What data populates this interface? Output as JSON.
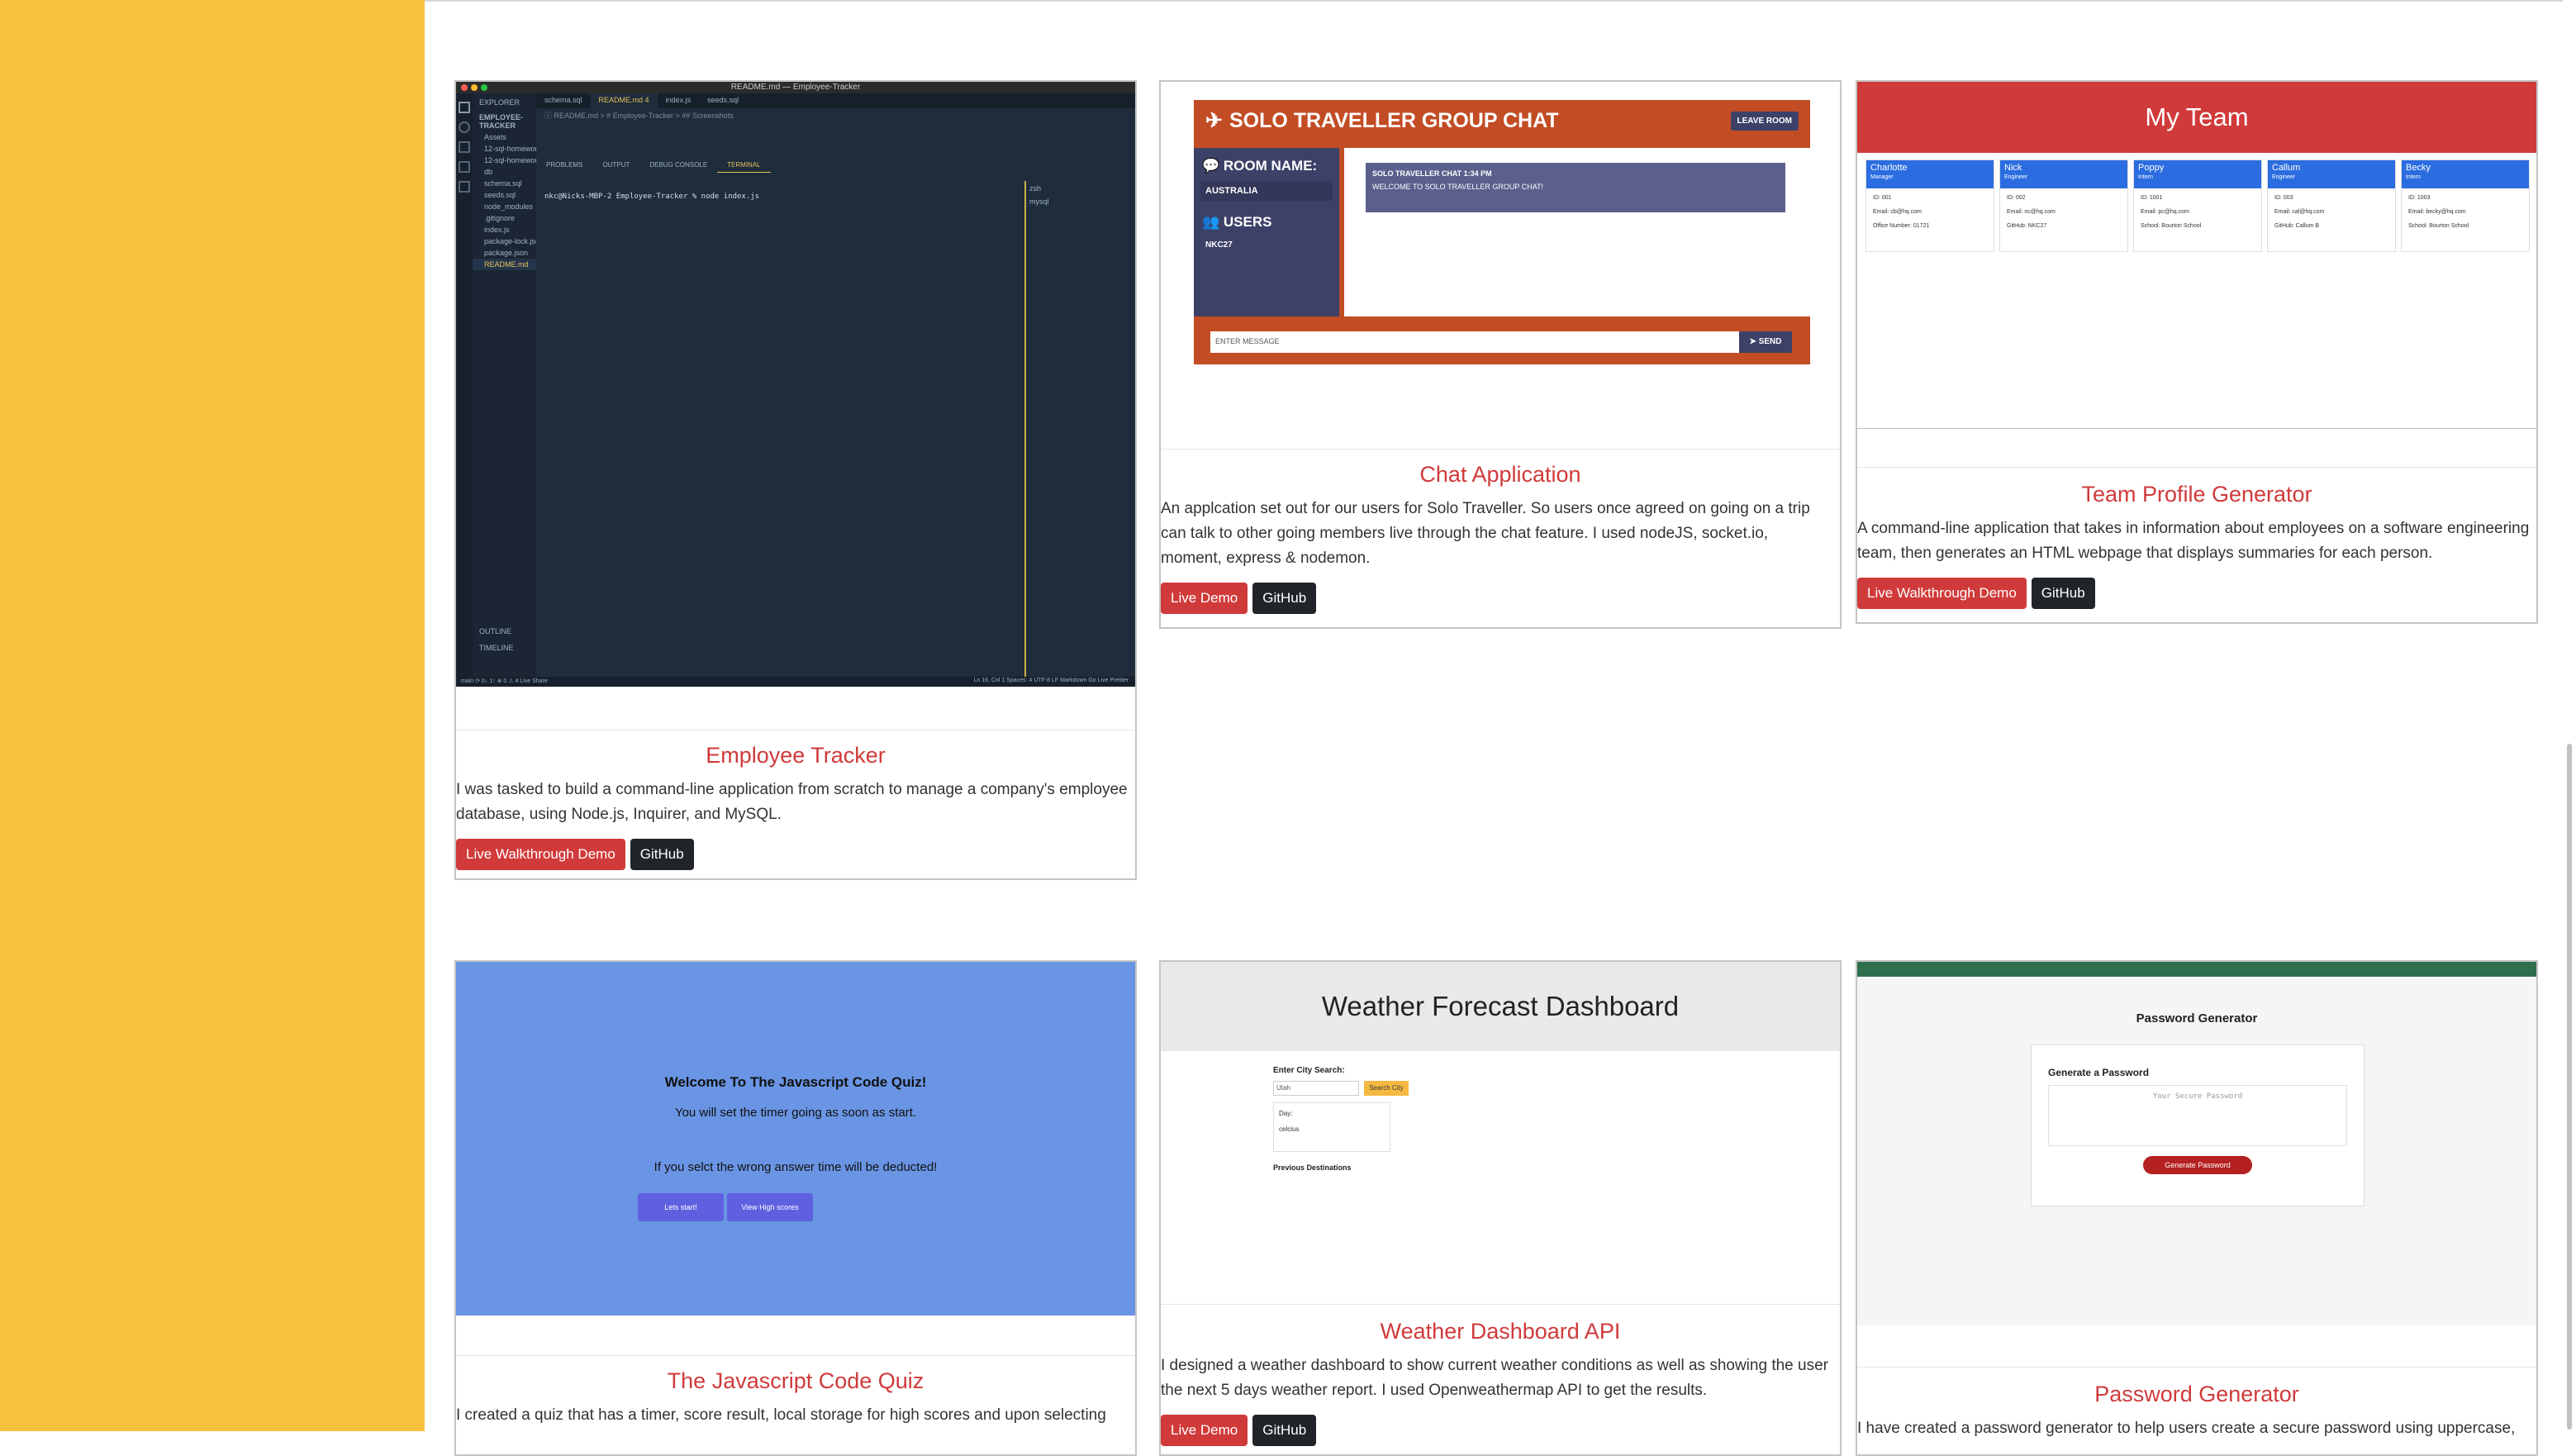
{
  "cards": [
    {
      "title": "Employee Tracker",
      "description": "I was tasked to build a command-line application from scratch to manage a company's employee database, using Node.js, Inquirer, and MySQL.",
      "demo_label": "Live Walkthrough Demo",
      "github_label": "GitHub",
      "preview": {
        "window_title": "README.md — Employee-Tracker",
        "explorer_label": "EXPLORER",
        "project_label": "EMPLOYEE-TRACKER",
        "tabs": [
          "schema.sql",
          "README.md 4",
          "index.js",
          "seeds.sql"
        ],
        "breadcrumb": "ⓘ README.md > # Employee-Tracker > ## Screenshots",
        "files": [
          "Assets",
          "12-sql-homework-...",
          "12-sql-homework-...",
          "db",
          "schema.sql",
          "seeds.sql",
          "node_modules",
          ".gitignore",
          "index.js",
          "package-lock.json",
          "package.json",
          "README.md"
        ],
        "panel_tabs": [
          "PROBLEMS",
          "OUTPUT",
          "DEBUG CONSOLE",
          "TERMINAL"
        ],
        "terminal_line": "nkc@Nicks-MBP-2 Employee-Tracker % node index.js",
        "terminals": [
          "zsh",
          "mysql"
        ],
        "outline_label": "OUTLINE",
        "timeline_label": "TIMELINE",
        "status_left": "main   ⟳ 0↓ 1↑   ⊗ 0 ⚠ 4   Live Share",
        "status_right": "Ln 16, Col 1   Spaces: 4   UTF-8   LF   Markdown   Go Live   Prettier"
      }
    },
    {
      "title": "Chat Application",
      "description": "An applcation set out for our users for Solo Traveller. So users once agreed on going on a trip can talk to other going members live through the chat feature. I used nodeJS, socket.io, moment, express & nodemon.",
      "demo_label": "Live Demo",
      "github_label": "GitHub",
      "preview": {
        "header": "SOLO TRAVELLER GROUP CHAT",
        "leave_label": "LEAVE ROOM",
        "room_label": "ROOM NAME:",
        "room_value": "AUSTRALIA",
        "users_label": "USERS",
        "user": "NKC27",
        "msg_meta": "SOLO TRAVELLER CHAT 1:34 PM",
        "msg_text": "WELCOME TO SOLO TRAVELLER GROUP CHAT!",
        "input_placeholder": "ENTER MESSAGE",
        "send_label": "SEND"
      }
    },
    {
      "title": "Team Profile Generator",
      "description": "A command-line application that takes in information about employees on a software engineering team, then generates an HTML webpage that displays summaries for each person.",
      "demo_label": "Live Walkthrough Demo",
      "github_label": "GitHub",
      "preview": {
        "header": "My Team",
        "members": [
          {
            "name": "Charlotte",
            "role": "Manager",
            "id": "ID: 001",
            "email": "Email: cb@hq.com",
            "extra": "Office Number: 01721"
          },
          {
            "name": "Nick",
            "role": "Engineer",
            "id": "ID: 002",
            "email": "Email: nc@hq.com",
            "extra": "GitHub: NKC27"
          },
          {
            "name": "Poppy",
            "role": "Intern",
            "id": "ID: 1001",
            "email": "Email: pc@hq.com",
            "extra": "School: Bourton School"
          },
          {
            "name": "Callum",
            "role": "Engineer",
            "id": "ID: 003",
            "email": "Email: cal@hq.com",
            "extra": "GitHub: Callum B"
          },
          {
            "name": "Becky",
            "role": "Intern",
            "id": "ID: 1003",
            "email": "Email: becky@hq.com",
            "extra": "School: Bourton School"
          }
        ]
      }
    },
    {
      "title": "The Javascript Code Quiz",
      "description": "I created a quiz that has a timer, score result, local storage for high scores and upon selecting",
      "preview": {
        "heading": "Welcome To The Javascript Code Quiz!",
        "line1": "You will set the timer going as soon as start.",
        "line2": "If you selct the wrong answer time will be deducted!",
        "start_label": "Lets start!",
        "scores_label": "View High scores"
      }
    },
    {
      "title": "Weather Dashboard API",
      "description": "I designed a weather dashboard to show current weather conditions as well as showing the user the next 5 days weather report. I used Openweathermap API to get the results.",
      "demo_label": "Live Demo",
      "github_label": "GitHub",
      "preview": {
        "header": "Weather Forecast Dashboard",
        "search_label": "Enter City Search:",
        "search_value": "Utah",
        "search_button": "Search City",
        "day_label": "Day:",
        "day_value": "celcius",
        "previous_label": "Previous Destinations"
      }
    },
    {
      "title": "Password Generator",
      "description": "I have created a password generator to help users create a secure password using uppercase,",
      "preview": {
        "heading": "Password Generator",
        "box_title": "Generate a Password",
        "placeholder": "Your Secure Password",
        "button": "Generate Password"
      }
    }
  ]
}
